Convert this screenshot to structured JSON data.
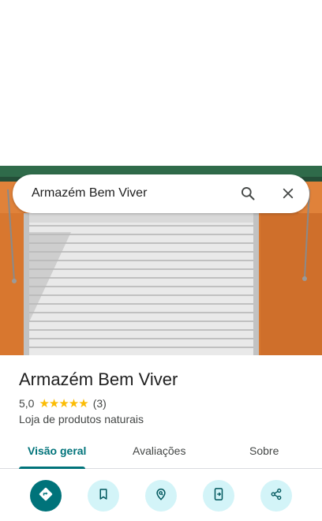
{
  "search": {
    "query": "Armazém Bem Viver",
    "search_icon": "search-icon",
    "close_icon": "close-icon"
  },
  "place": {
    "name": "Armazém Bem Viver",
    "rating": "5,0",
    "rating_stars": 5,
    "stars_text": "★★★★★",
    "review_count": "(3)",
    "category": "Loja de produtos naturais"
  },
  "tabs": [
    {
      "label": "Visão geral",
      "active": true
    },
    {
      "label": "Avaliações",
      "active": false
    },
    {
      "label": "Sobre",
      "active": false
    }
  ],
  "actions": [
    {
      "icon": "directions-icon"
    },
    {
      "icon": "bookmark-icon"
    },
    {
      "icon": "nearby-icon"
    },
    {
      "icon": "send-to-phone-icon"
    },
    {
      "icon": "share-icon"
    }
  ],
  "colors": {
    "accent": "#00737a",
    "accent_light": "#d3f4f8",
    "star": "#fbbc04",
    "wall": "#d8772f"
  }
}
